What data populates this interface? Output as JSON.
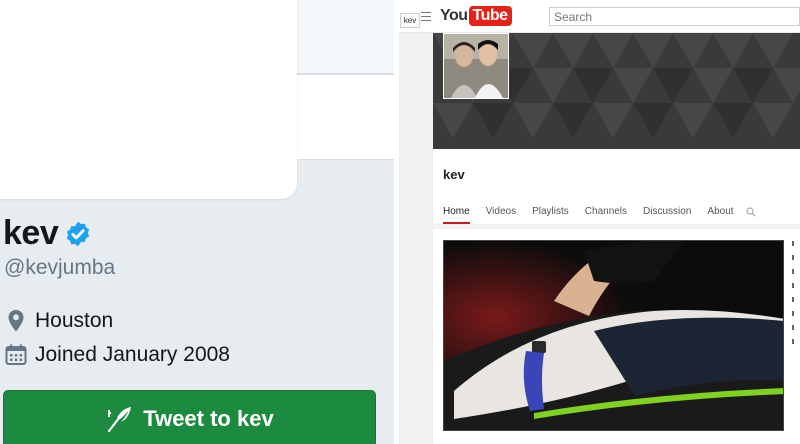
{
  "twitter": {
    "name": "kev",
    "handle": "@kevjumba",
    "location": "Houston",
    "joined": "Joined January 2008",
    "tweet_button_label": "Tweet to kev",
    "accent_color": "#1d8b3f",
    "verified_color": "#1da1f2"
  },
  "youtube": {
    "account_label": "kev",
    "logo_you": "You",
    "logo_tube": "Tube",
    "search_placeholder": "Search",
    "channel_name": "kev",
    "tabs": [
      {
        "label": "Home",
        "active": true
      },
      {
        "label": "Videos",
        "active": false
      },
      {
        "label": "Playlists",
        "active": false
      },
      {
        "label": "Channels",
        "active": false
      },
      {
        "label": "Discussion",
        "active": false
      },
      {
        "label": "About",
        "active": false
      }
    ],
    "brand_color": "#e62117",
    "icons": [
      "menu-icon",
      "search-icon"
    ]
  }
}
